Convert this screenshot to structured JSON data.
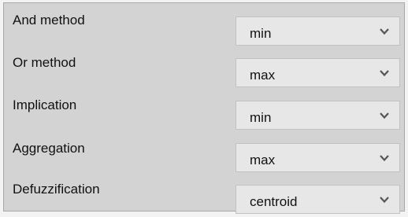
{
  "settings": {
    "rows": [
      {
        "label": "And method",
        "value": "min"
      },
      {
        "label": "Or method",
        "value": "max"
      },
      {
        "label": "Implication",
        "value": "min"
      },
      {
        "label": "Aggregation",
        "value": "max"
      },
      {
        "label": "Defuzzification",
        "value": "centroid"
      }
    ]
  },
  "icons": {
    "dropdown": "chevron-down-icon"
  },
  "colors": {
    "panel_background": "#d3d3d3",
    "select_background": "#e7e7e7",
    "chevron": "#555555"
  }
}
